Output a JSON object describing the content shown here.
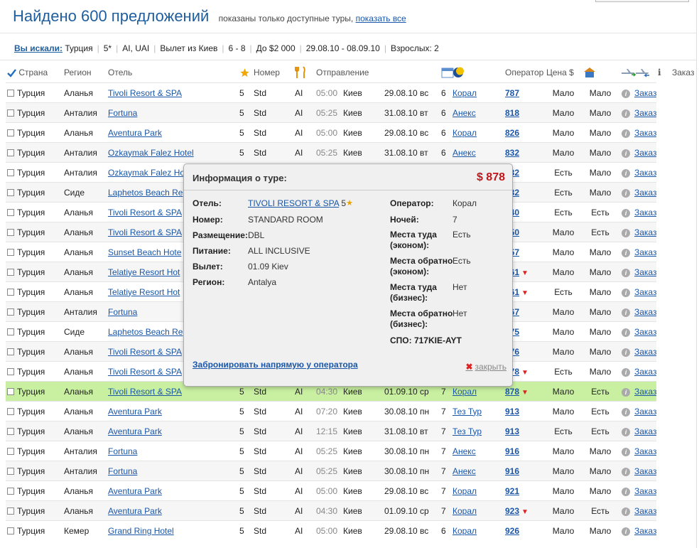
{
  "header": {
    "title": "Найдено 600 предложений",
    "note": "показаны только доступные туры,",
    "show_all": "показать все"
  },
  "search": {
    "label": "Вы искали:",
    "items": [
      "Турция",
      "5*",
      "AI, UAI",
      "Вылет из Киев",
      "6 - 8",
      "До $2 000",
      "29.08.10 - 08.09.10",
      "Взрослых: 2"
    ]
  },
  "columns": {
    "country": "Страна",
    "region": "Регион",
    "hotel": "Отель",
    "room": "Номер",
    "departure": "Отправление",
    "operator": "Оператор",
    "price": "Цена $",
    "order": "Заказ"
  },
  "icons": {
    "check": "checkmark-icon",
    "star": "star-icon",
    "food": "fork-knife-icon",
    "calendar": "calendar-icon",
    "nights": "moon-icon",
    "hotel": "hotel-icon",
    "flight_out": "plane-departure-icon",
    "flight_back": "plane-arrival-icon",
    "info": "info-icon"
  },
  "rows": [
    {
      "country": "Турция",
      "region": "Аланья",
      "hotel": "Tivoli Resort & SPA",
      "stars": "5",
      "room": "Std",
      "meal": "AI",
      "time": "05:00",
      "city": "Киев",
      "date": "29.08.10 вс",
      "nights": "6",
      "operator": "Корал",
      "price": "787",
      "down": "",
      "out": "Мало",
      "back": "Мало",
      "order": "Заказ"
    },
    {
      "country": "Турция",
      "region": "Анталия",
      "hotel": "Fortuna",
      "stars": "5",
      "room": "Std",
      "meal": "AI",
      "time": "05:25",
      "city": "Киев",
      "date": "31.08.10 вт",
      "nights": "6",
      "operator": "Анекс",
      "price": "818",
      "down": "",
      "out": "Мало",
      "back": "Мало",
      "order": "Заказ"
    },
    {
      "country": "Турция",
      "region": "Аланья",
      "hotel": "Aventura Park",
      "stars": "5",
      "room": "Std",
      "meal": "AI",
      "time": "05:00",
      "city": "Киев",
      "date": "29.08.10 вс",
      "nights": "6",
      "operator": "Корал",
      "price": "826",
      "down": "",
      "out": "Мало",
      "back": "Мало",
      "order": "Заказ"
    },
    {
      "country": "Турция",
      "region": "Анталия",
      "hotel": "Ozkaymak Falez Hotel",
      "stars": "5",
      "room": "Std",
      "meal": "AI",
      "time": "05:25",
      "city": "Киев",
      "date": "31.08.10 вт",
      "nights": "6",
      "operator": "Анекс",
      "price": "832",
      "down": "",
      "out": "Мало",
      "back": "Мало",
      "order": "Заказ"
    },
    {
      "country": "Турция",
      "region": "Анталия",
      "hotel": "Ozkaymak Falez Ho",
      "stars": "",
      "room": "",
      "meal": "",
      "time": "",
      "city": "",
      "date": "",
      "nights": "",
      "operator": "",
      "price": "832",
      "down": "",
      "out": "Есть",
      "back": "Мало",
      "order": "Заказ"
    },
    {
      "country": "Турция",
      "region": "Сиде",
      "hotel": "Laphetos Beach Re",
      "stars": "",
      "room": "",
      "meal": "",
      "time": "",
      "city": "",
      "date": "",
      "nights": "",
      "operator": "",
      "price": "832",
      "down": "",
      "out": "Есть",
      "back": "Мало",
      "order": "Заказ"
    },
    {
      "country": "Турция",
      "region": "Аланья",
      "hotel": "Tivoli Resort & SPA",
      "stars": "",
      "room": "",
      "meal": "",
      "time": "",
      "city": "",
      "date": "",
      "nights": "",
      "operator": "",
      "price": "840",
      "down": "",
      "out": "Есть",
      "back": "Есть",
      "order": "Заказ"
    },
    {
      "country": "Турция",
      "region": "Аланья",
      "hotel": "Tivoli Resort & SPA",
      "stars": "",
      "room": "",
      "meal": "",
      "time": "",
      "city": "",
      "date": "",
      "nights": "",
      "operator": "",
      "price": "850",
      "down": "",
      "out": "Мало",
      "back": "Есть",
      "order": "Заказ"
    },
    {
      "country": "Турция",
      "region": "Аланья",
      "hotel": "Sunset Beach Hote",
      "stars": "",
      "room": "",
      "meal": "",
      "time": "",
      "city": "",
      "date": "",
      "nights": "",
      "operator": "",
      "price": "857",
      "down": "",
      "out": "Мало",
      "back": "Мало",
      "order": "Заказ"
    },
    {
      "country": "Турция",
      "region": "Аланья",
      "hotel": "Telatiye Resort Hot",
      "stars": "",
      "room": "",
      "meal": "",
      "time": "",
      "city": "",
      "date": "",
      "nights": "",
      "operator": "",
      "price": "861",
      "down": "▼",
      "out": "Мало",
      "back": "Мало",
      "order": "Заказ"
    },
    {
      "country": "Турция",
      "region": "Аланья",
      "hotel": "Telatiye Resort Hot",
      "stars": "",
      "room": "",
      "meal": "",
      "time": "",
      "city": "",
      "date": "",
      "nights": "",
      "operator": "",
      "price": "861",
      "down": "▼",
      "out": "Есть",
      "back": "Мало",
      "order": "Заказ"
    },
    {
      "country": "Турция",
      "region": "Анталия",
      "hotel": "Fortuna",
      "stars": "",
      "room": "",
      "meal": "",
      "time": "",
      "city": "",
      "date": "",
      "nights": "",
      "operator": "",
      "price": "867",
      "down": "",
      "out": "Мало",
      "back": "Мало",
      "order": "Заказ"
    },
    {
      "country": "Турция",
      "region": "Сиде",
      "hotel": "Laphetos Beach Re",
      "stars": "",
      "room": "",
      "meal": "",
      "time": "",
      "city": "",
      "date": "",
      "nights": "",
      "operator": "",
      "price": "875",
      "down": "",
      "out": "Мало",
      "back": "Мало",
      "order": "Заказ"
    },
    {
      "country": "Турция",
      "region": "Аланья",
      "hotel": "Tivoli Resort & SPA",
      "stars": "",
      "room": "",
      "meal": "",
      "time": "",
      "city": "",
      "date": "",
      "nights": "",
      "operator": "",
      "price": "876",
      "down": "",
      "out": "Мало",
      "back": "Мало",
      "order": "Заказ"
    },
    {
      "country": "Турция",
      "region": "Аланья",
      "hotel": "Tivoli Resort & SPA",
      "stars": "",
      "room": "",
      "meal": "",
      "time": "",
      "city": "",
      "date": "",
      "nights": "",
      "operator": "",
      "price": "878",
      "down": "▼",
      "out": "Есть",
      "back": "Мало",
      "order": "Заказ"
    },
    {
      "country": "Турция",
      "region": "Аланья",
      "hotel": "Tivoli Resort & SPA",
      "stars": "5",
      "room": "Std",
      "meal": "AI",
      "time": "04:30",
      "city": "Киев",
      "date": "01.09.10 ср",
      "nights": "7",
      "operator": "Корал",
      "price": "878",
      "down": "▼",
      "out": "Мало",
      "back": "Есть",
      "order": "Заказ"
    },
    {
      "country": "Турция",
      "region": "Аланья",
      "hotel": "Aventura Park",
      "stars": "5",
      "room": "Std",
      "meal": "AI",
      "time": "07:20",
      "city": "Киев",
      "date": "30.08.10 пн",
      "nights": "7",
      "operator": "Тез Тур",
      "price": "913",
      "down": "",
      "out": "Мало",
      "back": "Есть",
      "order": "Заказ"
    },
    {
      "country": "Турция",
      "region": "Аланья",
      "hotel": "Aventura Park",
      "stars": "5",
      "room": "Std",
      "meal": "AI",
      "time": "12:15",
      "city": "Киев",
      "date": "31.08.10 вт",
      "nights": "7",
      "operator": "Тез Тур",
      "price": "913",
      "down": "",
      "out": "Есть",
      "back": "Есть",
      "order": "Заказ"
    },
    {
      "country": "Турция",
      "region": "Анталия",
      "hotel": "Fortuna",
      "stars": "5",
      "room": "Std",
      "meal": "AI",
      "time": "05:25",
      "city": "Киев",
      "date": "30.08.10 пн",
      "nights": "7",
      "operator": "Анекс",
      "price": "916",
      "down": "",
      "out": "Мало",
      "back": "Мало",
      "order": "Заказ"
    },
    {
      "country": "Турция",
      "region": "Анталия",
      "hotel": "Fortuna",
      "stars": "5",
      "room": "Std",
      "meal": "AI",
      "time": "05:25",
      "city": "Киев",
      "date": "30.08.10 пн",
      "nights": "7",
      "operator": "Анекс",
      "price": "916",
      "down": "",
      "out": "Мало",
      "back": "Мало",
      "order": "Заказ"
    },
    {
      "country": "Турция",
      "region": "Аланья",
      "hotel": "Aventura Park",
      "stars": "5",
      "room": "Std",
      "meal": "AI",
      "time": "05:00",
      "city": "Киев",
      "date": "29.08.10 вс",
      "nights": "7",
      "operator": "Корал",
      "price": "921",
      "down": "",
      "out": "Мало",
      "back": "Мало",
      "order": "Заказ"
    },
    {
      "country": "Турция",
      "region": "Аланья",
      "hotel": "Aventura Park",
      "stars": "5",
      "room": "Std",
      "meal": "AI",
      "time": "04:30",
      "city": "Киев",
      "date": "01.09.10 ср",
      "nights": "7",
      "operator": "Корал",
      "price": "923",
      "down": "▼",
      "out": "Мало",
      "back": "Есть",
      "order": "Заказ"
    },
    {
      "country": "Турция",
      "region": "Кемер",
      "hotel": "Grand Ring Hotel",
      "stars": "5",
      "room": "Std",
      "meal": "AI",
      "time": "05:00",
      "city": "Киев",
      "date": "29.08.10 вс",
      "nights": "6",
      "operator": "Корал",
      "price": "926",
      "down": "",
      "out": "Мало",
      "back": "Мало",
      "order": "Заказ"
    }
  ],
  "popup": {
    "title": "Информация о туре:",
    "price": "$ 878",
    "left": [
      {
        "label": "Отель:",
        "value": "TIVOLI RESORT & SPA",
        "link": true,
        "stars": "5",
        "star": "★"
      },
      {
        "label": "Номер:",
        "value": "STANDARD ROOM"
      },
      {
        "label": "Размещение:",
        "value": "DBL"
      },
      {
        "label": "Питание:",
        "value": "ALL INCLUSIVE"
      },
      {
        "label": "Вылет:",
        "value": "01.09 Kiev"
      },
      {
        "label": "Регион:",
        "value": "Antalya"
      }
    ],
    "right": [
      {
        "label": "Оператор:",
        "value": "Корал"
      },
      {
        "label": "Ночей:",
        "value": "7"
      },
      {
        "label": "Места туда (эконом):",
        "value": "Есть"
      },
      {
        "label": "Места обратно (эконом):",
        "value": "Есть"
      },
      {
        "label": "Места туда (бизнес):",
        "value": "Нет"
      },
      {
        "label": "Места обратно (бизнес):",
        "value": "Нет"
      }
    ],
    "spo": "СПО: 717KIE-AYT",
    "book": "Забронировать напрямую у оператора",
    "close": "закрыть"
  }
}
